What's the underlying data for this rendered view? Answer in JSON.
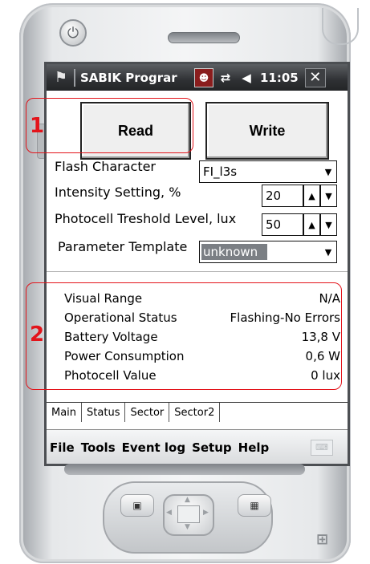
{
  "titlebar": {
    "app_title": "SABIK Prograr",
    "time": "11:05",
    "start_icon": "windows-flag-icon",
    "close_icon": "close-x"
  },
  "buttons": {
    "read": "Read",
    "write": "Write"
  },
  "form": {
    "flash_character": {
      "label": "Flash Character",
      "value": "FI_l3s"
    },
    "intensity": {
      "label": "Intensity Setting, %",
      "value": "20"
    },
    "photocell": {
      "label": "Photocell Treshold Level, lux",
      "value": "50"
    },
    "template": {
      "label": "Parameter Template",
      "value": "unknown"
    }
  },
  "status": [
    {
      "label": "Visual Range",
      "value": "N/A"
    },
    {
      "label": "Operational Status",
      "value": "Flashing-No Errors"
    },
    {
      "label": "Battery Voltage",
      "value": "13,8 V"
    },
    {
      "label": "Power Consumption",
      "value": "0,6 W"
    },
    {
      "label": "Photocell Value",
      "value": "0 lux"
    }
  ],
  "tabs": [
    "Main",
    "Status",
    "Sector",
    "Sector2"
  ],
  "menu": [
    "File",
    "Tools",
    "Event log",
    "Setup",
    "Help"
  ],
  "callouts": {
    "one": "1",
    "two": "2"
  },
  "colors": {
    "callout": "#e3141b",
    "titlebar": "#2f3134",
    "selection": "#7b7f84"
  }
}
